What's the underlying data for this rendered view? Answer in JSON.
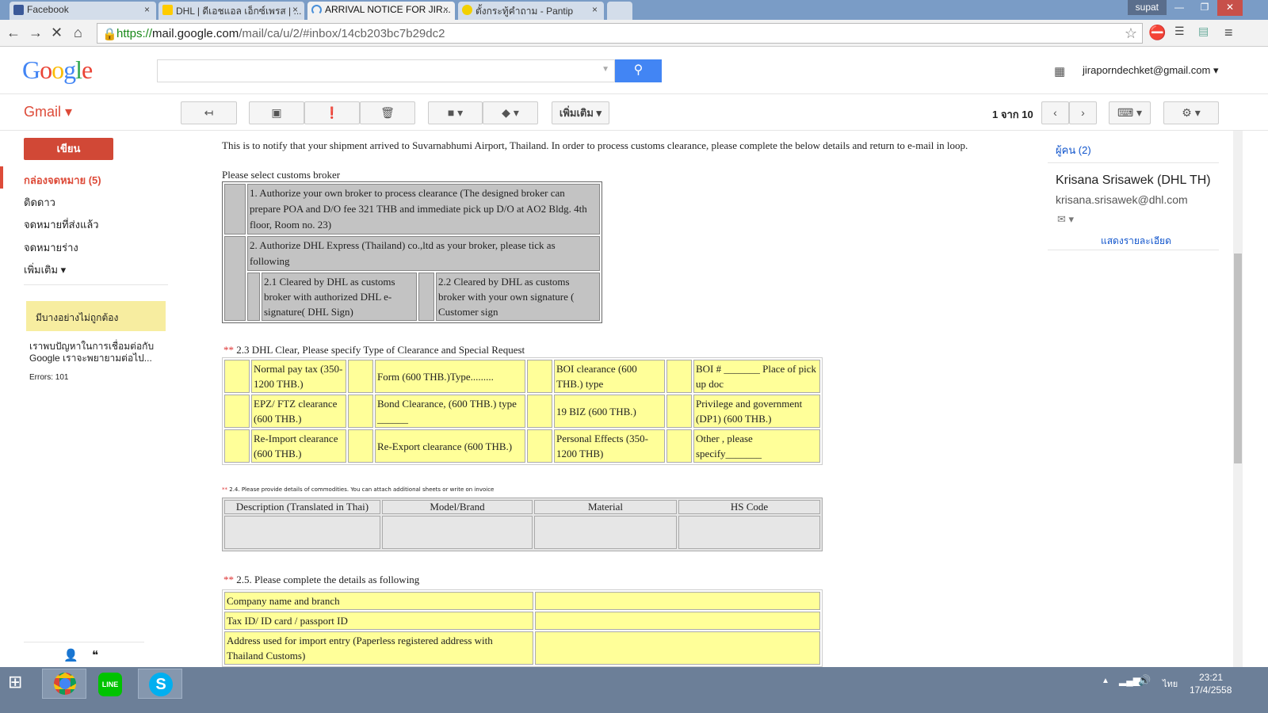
{
  "browser": {
    "tabs": [
      {
        "label": "Facebook",
        "icon": "facebook-icon",
        "color": "#3b5998"
      },
      {
        "label": "DHL | ดีเอชแอล เอ็กซ์เพรส | ...",
        "icon": "dhl-icon",
        "color": "#ffcc00"
      },
      {
        "label": "ARRIVAL NOTICE FOR JIR...",
        "icon": "loading-icon",
        "color": "#4a90d9"
      },
      {
        "label": "ตั้งกระทู้คำถาม - Pantip",
        "icon": "pantip-icon",
        "color": "#f2d000"
      }
    ],
    "user": "supat",
    "url_scheme": "https://",
    "url_host": "mail.google.com",
    "url_path": "/mail/ca/u/2/#inbox/14cb203bc7b29dc2"
  },
  "google": {
    "logo": "Google",
    "account": "jiraporndechket@gmail.com"
  },
  "gmail": {
    "label": "Gmail ▾",
    "more": "เพิ่มเติม ▾",
    "pager": "1 จาก 10"
  },
  "sidebar": {
    "compose": "เขียน",
    "items": [
      "กล่องจดหมาย (5)",
      "ติดดาว",
      "จดหมายที่ส่งแล้ว",
      "จดหมายร่าง",
      "เพิ่มเติม ▾"
    ],
    "error_title": "มีบางอย่างไม่ถูกต้อง",
    "error_msg": "เราพบปัญหาในการเชื่อมต่อกับ Google เราจะพยายามต่อไป...",
    "error_count": "Errors: 101"
  },
  "email": {
    "intro": "This is to notify that your shipment arrived to Suvarnabhumi Airport, Thailand. In order to process customs clearance, please complete the below details and return to e-mail in loop.",
    "broker_heading": "Please select customs broker",
    "opt1": "1. Authorize your own broker  to process clearance (The designed broker can prepare POA and D/O fee 321 THB and immediate pick up D/O at  AO2  Bldg. 4th floor, Room no. 23)",
    "opt2": "2. Authorize DHL Express (Thailand) co.,ltd as your broker, please tick as following",
    "opt21": "2.1 Cleared by DHL as customs broker with authorized DHL e-signature( DHL Sign)",
    "opt22": "2.2 Cleared by DHL as customs broker with your own signature ( Customer sign",
    "s23": "2.3 DHL Clear, Please specify Type of Clearance and Special Request",
    "clearance": [
      [
        "Normal pay tax (350-1200 THB.)",
        "Form (600 THB.)Type.........",
        "BOI clearance (600 THB.) type",
        "BOI # _______ Place of pick up doc"
      ],
      [
        "EPZ/ FTZ clearance (600 THB.)",
        "Bond Clearance, (600 THB.) type ______",
        "19  BIZ (600 THB.)",
        "Privilege and government (DP1) (600 THB.)"
      ],
      [
        "Re-Import clearance (600 THB.)",
        "Re-Export clearance (600 THB.)",
        "Personal Effects (350-1200 THB)",
        "Other , please specify_______"
      ]
    ],
    "s24": "2.4. Please provide details of commodities. You can attach additional sheets or write on invoice",
    "commodity_headers": [
      "Description (Translated in Thai)",
      "Model/Brand",
      "Material",
      "HS Code"
    ],
    "s25": "2.5. Please complete the details as following",
    "details": [
      "Company name and branch",
      "Tax ID/ ID card / passport ID",
      "Address used for import entry (Paperless registered address with Thailand Customs)"
    ],
    "stars": "**"
  },
  "contact": {
    "people": "ผู้คน (2)",
    "name": "Krisana Srisawek (DHL TH)",
    "email": "krisana.srisawek@dhl.com",
    "details": "แสดงรายละเอียด"
  },
  "taskbar": {
    "time": "23:21",
    "date": "17/4/2558",
    "lang": "ไทย"
  }
}
